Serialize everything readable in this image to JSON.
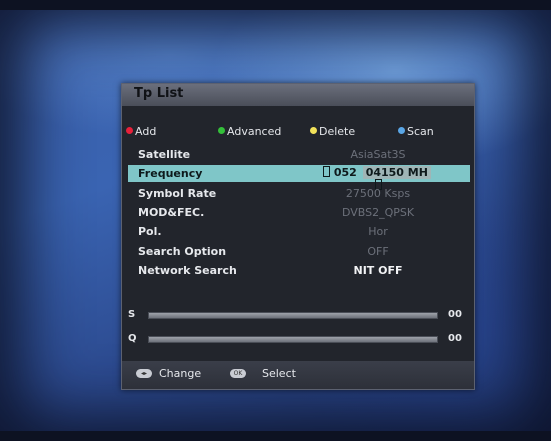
{
  "dialog": {
    "title": "Tp List"
  },
  "legend": {
    "add": {
      "label": "Add",
      "color": "#e8203a"
    },
    "advanced": {
      "label": "Advanced",
      "color": "#34c03a"
    },
    "delete": {
      "label": "Delete",
      "color": "#f2e25a"
    },
    "scan": {
      "label": "Scan",
      "color": "#5aa6e6"
    }
  },
  "rows": [
    {
      "label": "Satellite",
      "value": "AsiaSat3S"
    },
    {
      "label": "Frequency",
      "value_a": "052",
      "value_b": "04150 MH",
      "selected": true
    },
    {
      "label": "Symbol Rate",
      "value": "27500 Ksps"
    },
    {
      "label": "MOD&FEC.",
      "value": "DVBS2_QPSK"
    },
    {
      "label": "Pol.",
      "value": "Hor"
    },
    {
      "label": "Search Option",
      "value": "OFF"
    },
    {
      "label": "Network Search",
      "value": "NIT OFF"
    }
  ],
  "signal": {
    "strength": {
      "label": "S",
      "value": "00"
    },
    "quality": {
      "label": "Q",
      "value": "00"
    }
  },
  "footer": {
    "change_label": "Change",
    "select_label": "Select",
    "change_key_icon": "left-right-key-icon",
    "select_key_icon": "ok-key-icon",
    "change_key_text": "◂▸",
    "select_key_text": "OK"
  }
}
